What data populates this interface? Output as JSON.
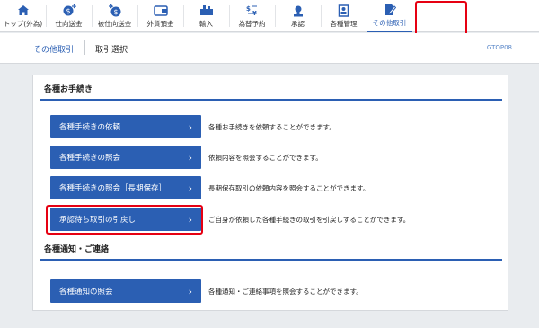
{
  "nav": {
    "items": [
      {
        "label": "トップ(外為)",
        "icon": "home-icon"
      },
      {
        "label": "仕向送金",
        "icon": "outward-remittance-icon"
      },
      {
        "label": "被仕向送金",
        "icon": "inward-remittance-icon"
      },
      {
        "label": "外貨預金",
        "icon": "foreign-deposit-icon"
      },
      {
        "label": "輸入",
        "icon": "import-icon"
      },
      {
        "label": "為替予約",
        "icon": "fx-contract-icon"
      },
      {
        "label": "承認",
        "icon": "approval-icon"
      },
      {
        "label": "各種管理",
        "icon": "management-icon"
      },
      {
        "label": "その他取引",
        "icon": "other-transactions-icon"
      }
    ],
    "active_index": 8,
    "accent_color": "#2b5fb3",
    "highlight_color": "#e60012"
  },
  "titlebar": {
    "parent": "その他取引",
    "current": "取引選択",
    "screen_id": "GTOP08"
  },
  "sections": [
    {
      "heading": "各種お手続き",
      "rows": [
        {
          "button": "各種手続きの依頼",
          "description": "各種お手続きを依頼することができます。"
        },
        {
          "button": "各種手続きの照会",
          "description": "依頼内容を照会することができます。"
        },
        {
          "button": "各種手続きの照会［長期保存］",
          "description": "長期保存取引の依頼内容を照会することができます。"
        },
        {
          "button": "承認待ち取引の引戻し",
          "description": "ご自身が依頼した各種手続きの取引を引戻しすることができます。",
          "highlighted": true
        }
      ]
    },
    {
      "heading": "各種通知・ご連絡",
      "rows": [
        {
          "button": "各種通知の照会",
          "description": "各種通知・ご連絡事項を照会することができます。"
        }
      ]
    }
  ]
}
